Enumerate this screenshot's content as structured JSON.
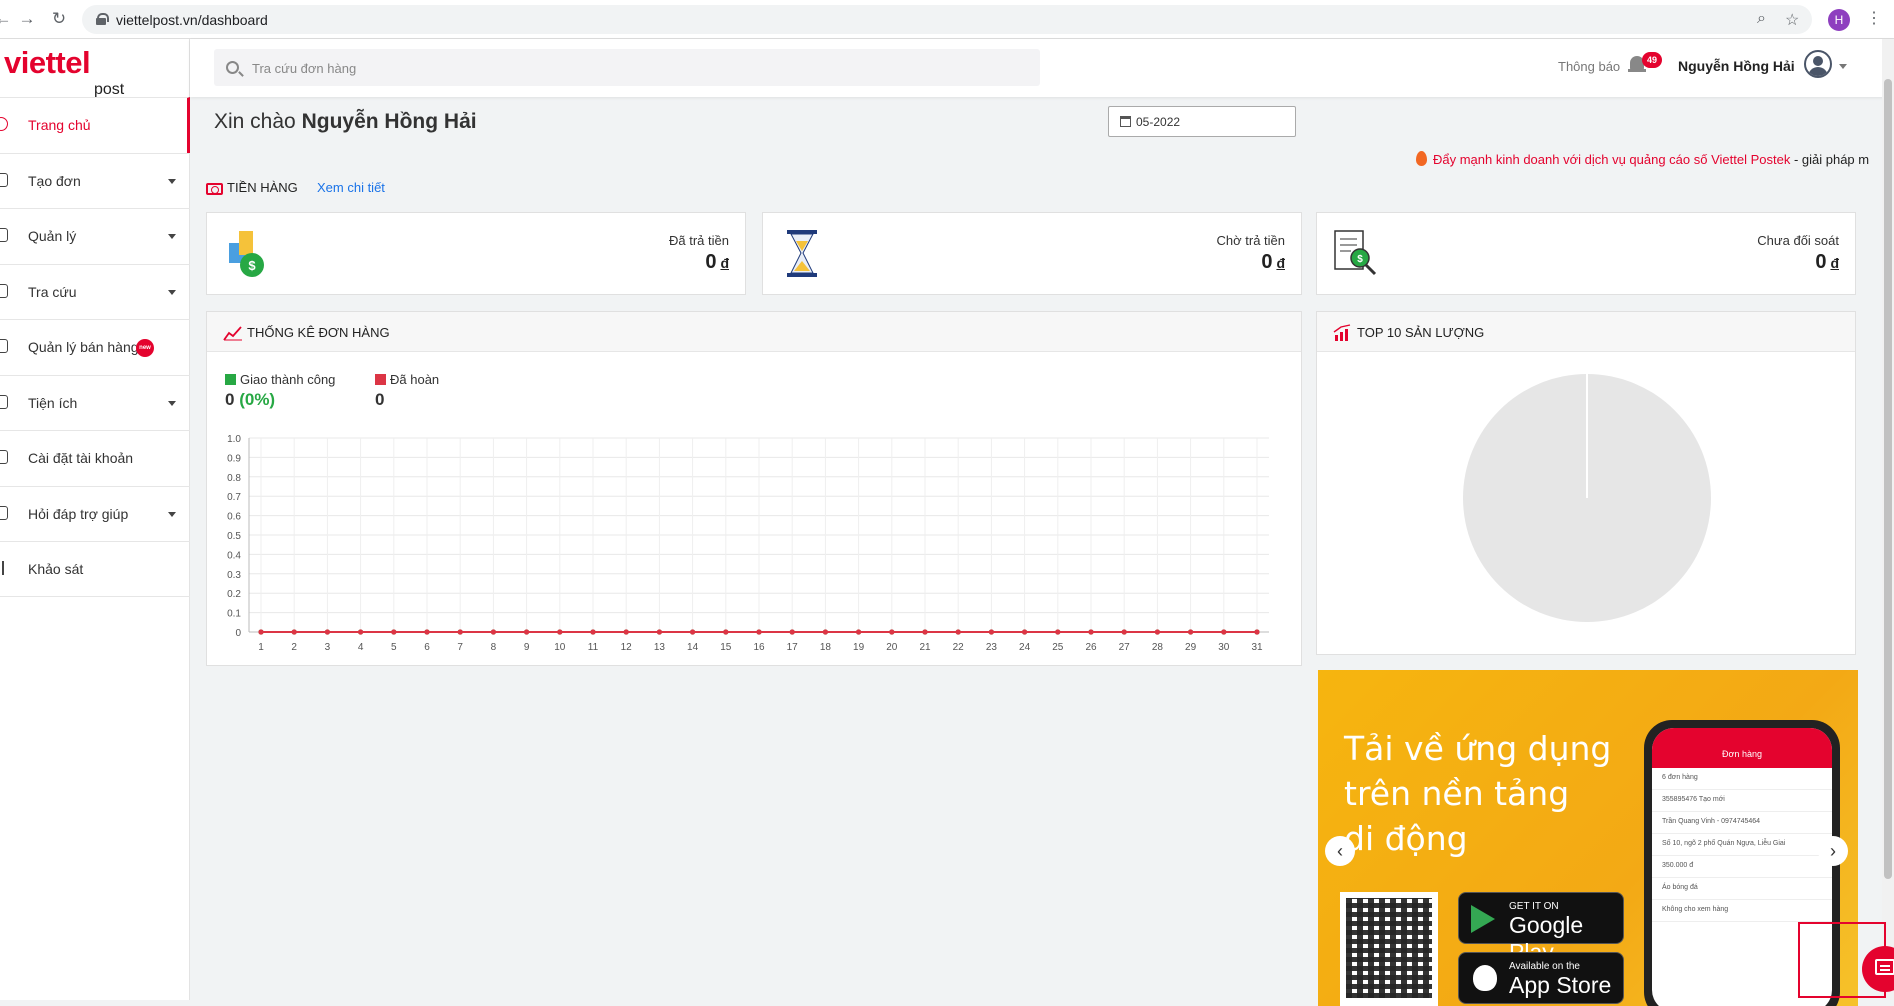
{
  "browser": {
    "url": "viettelpost.vn/dashboard",
    "profile_initial": "H"
  },
  "logo": {
    "main": "viettel",
    "sub": "post",
    "color": "#e4032e"
  },
  "sidebar": {
    "items": [
      {
        "label": "Trang chủ",
        "active": true,
        "has_caret": false
      },
      {
        "label": "Tạo đơn",
        "has_caret": true
      },
      {
        "label": "Quản lý",
        "has_caret": true
      },
      {
        "label": "Tra cứu",
        "has_caret": true
      },
      {
        "label": "Quản lý bán hàng",
        "has_caret": false,
        "badge": "new"
      },
      {
        "label": "Tiện ích",
        "has_caret": true
      },
      {
        "label": "Cài đặt tài khoản",
        "has_caret": false
      },
      {
        "label": "Hỏi đáp trợ giúp",
        "has_caret": true
      },
      {
        "label": "Khảo sát",
        "has_caret": false
      }
    ]
  },
  "header": {
    "search_placeholder": "Tra cứu đơn hàng",
    "notification_label": "Thông báo",
    "notification_count": "49",
    "user_name": "Nguyễn Hồng Hải"
  },
  "main": {
    "greeting_prefix": "Xin chào",
    "greeting_name": "Nguyễn Hồng Hải",
    "month": "05-2022",
    "promo_link": "Đẩy mạnh kinh doanh với dịch vụ quảng cáo số Viettel Postek",
    "promo_rest": " - giải pháp m",
    "money_section_title": "TIỀN HÀNG",
    "money_section_link": "Xem chi tiết",
    "stats": [
      {
        "label": "Đã trả tiền",
        "value": "0",
        "currency": "đ",
        "icon": "money-bag-icon"
      },
      {
        "label": "Chờ trả tiền",
        "value": "0",
        "currency": "đ",
        "icon": "hourglass-icon"
      },
      {
        "label": "Chưa đối soát",
        "value": "0",
        "currency": "đ",
        "icon": "document-search-icon"
      }
    ],
    "order_stats_title": "THỐNG KÊ ĐƠN HÀNG",
    "legend": [
      {
        "label": "Giao thành công",
        "value": "0",
        "pct": "(0%)",
        "color": "#27a844"
      },
      {
        "label": "Đã hoàn",
        "value": "0",
        "color": "#dc3545"
      }
    ],
    "top10_title": "TOP 10 SẢN LƯỢNG"
  },
  "chart_data": {
    "type": "line",
    "x": [
      1,
      2,
      3,
      4,
      5,
      6,
      7,
      8,
      9,
      10,
      11,
      12,
      13,
      14,
      15,
      16,
      17,
      18,
      19,
      20,
      21,
      22,
      23,
      24,
      25,
      26,
      27,
      28,
      29,
      30,
      31
    ],
    "y_ticks": [
      "0",
      "0.1",
      "0.2",
      "0.3",
      "0.4",
      "0.5",
      "0.6",
      "0.7",
      "0.8",
      "0.9",
      "1.0"
    ],
    "ylim": [
      0,
      1
    ],
    "grid": true,
    "series": [
      {
        "name": "Giao thành công",
        "color": "#27a844",
        "values": [
          0,
          0,
          0,
          0,
          0,
          0,
          0,
          0,
          0,
          0,
          0,
          0,
          0,
          0,
          0,
          0,
          0,
          0,
          0,
          0,
          0,
          0,
          0,
          0,
          0,
          0,
          0,
          0,
          0,
          0,
          0
        ]
      },
      {
        "name": "Đã hoàn",
        "color": "#dc3545",
        "values": [
          0,
          0,
          0,
          0,
          0,
          0,
          0,
          0,
          0,
          0,
          0,
          0,
          0,
          0,
          0,
          0,
          0,
          0,
          0,
          0,
          0,
          0,
          0,
          0,
          0,
          0,
          0,
          0,
          0,
          0,
          0
        ]
      }
    ]
  },
  "banner": {
    "lines": [
      "Tải về ứng dụng",
      "trên nền tảng",
      "di động"
    ],
    "google_small": "GET IT ON",
    "google_big": "Google Play",
    "apple_small": "Available on the",
    "apple_big": "App Store",
    "phone_title": "Đơn hàng",
    "phone_rows": [
      "6 đơn hàng",
      "355895476  Tạo mới",
      "Trần Quang Vinh - 0974745464",
      "Số 10, ngõ 2 phố Quán Ngựa, Liễu Giai",
      "350.000 đ",
      "Áo bóng đá",
      "Không cho xem hàng"
    ]
  }
}
